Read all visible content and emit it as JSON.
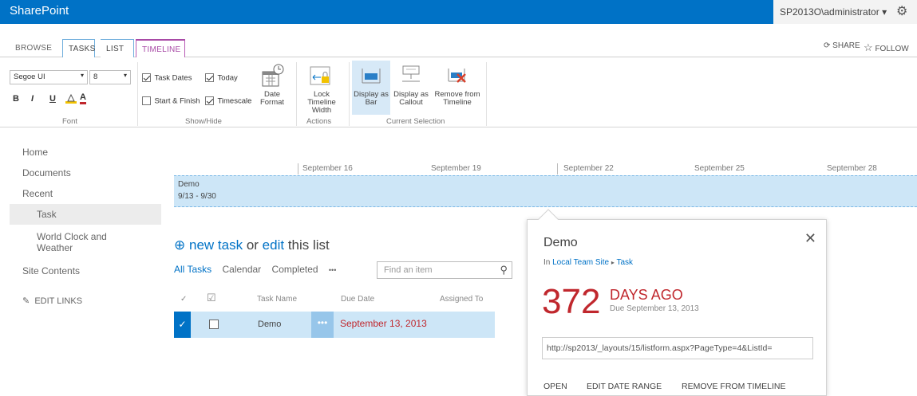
{
  "app": {
    "brand": "SharePoint",
    "user": "SP2013O\\administrator ▾"
  },
  "tabs": [
    "BROWSE",
    "TASKS",
    "LIST",
    "TIMELINE"
  ],
  "social": {
    "share": "SHARE",
    "follow": "FOLLOW"
  },
  "ribbon": {
    "font": {
      "family": "Segoe UI",
      "size": "8",
      "bold": "B",
      "italic": "I",
      "underline": "U",
      "color_a": "A",
      "label": "Font"
    },
    "showhide": {
      "task_dates": "Task Dates",
      "today": "Today",
      "start_finish": "Start & Finish",
      "timescale": "Timescale",
      "date_format": "Date Format",
      "label": "Show/Hide"
    },
    "actions": {
      "lock_width": "Lock Timeline Width",
      "label": "Actions"
    },
    "selection": {
      "display_bar": "Display as Bar",
      "display_callout": "Display as Callout",
      "remove": "Remove from Timeline",
      "label": "Current Selection"
    }
  },
  "nav": [
    "Home",
    "Documents",
    "Recent",
    "Task",
    "World Clock and Weather",
    "Site Contents",
    "EDIT LINKS"
  ],
  "timeline": {
    "dates": [
      "September 16",
      "September 19",
      "September 22",
      "September 25",
      "September 28"
    ],
    "bar_name": "Demo",
    "bar_range": "9/13 - 9/30"
  },
  "list": {
    "new_task": "new task",
    "or": "or",
    "edit": "edit",
    "this_list": "this list",
    "views": [
      "All Tasks",
      "Calendar",
      "Completed",
      "•••"
    ],
    "search_placeholder": "Find an item",
    "columns": [
      "Task Name",
      "Due Date",
      "Assigned To"
    ],
    "rows": [
      {
        "name": "Demo",
        "due": "September 13, 2013"
      }
    ]
  },
  "callout": {
    "title": "Demo",
    "path_prefix": "In",
    "path_site": "Local Team Site",
    "path_list": "Task",
    "number": "372",
    "days_ago": "DAYS AGO",
    "due": "Due September 13, 2013",
    "url": "http://sp2013/_layouts/15/listform.aspx?PageType=4&ListId=",
    "actions": [
      "OPEN",
      "EDIT DATE RANGE",
      "REMOVE FROM TIMELINE"
    ]
  },
  "colors": {
    "suite_bar": "#0072c6",
    "accent_purple": "#a84aa6",
    "due_red": "#c0272d",
    "selection_blue": "#cde6f7"
  }
}
